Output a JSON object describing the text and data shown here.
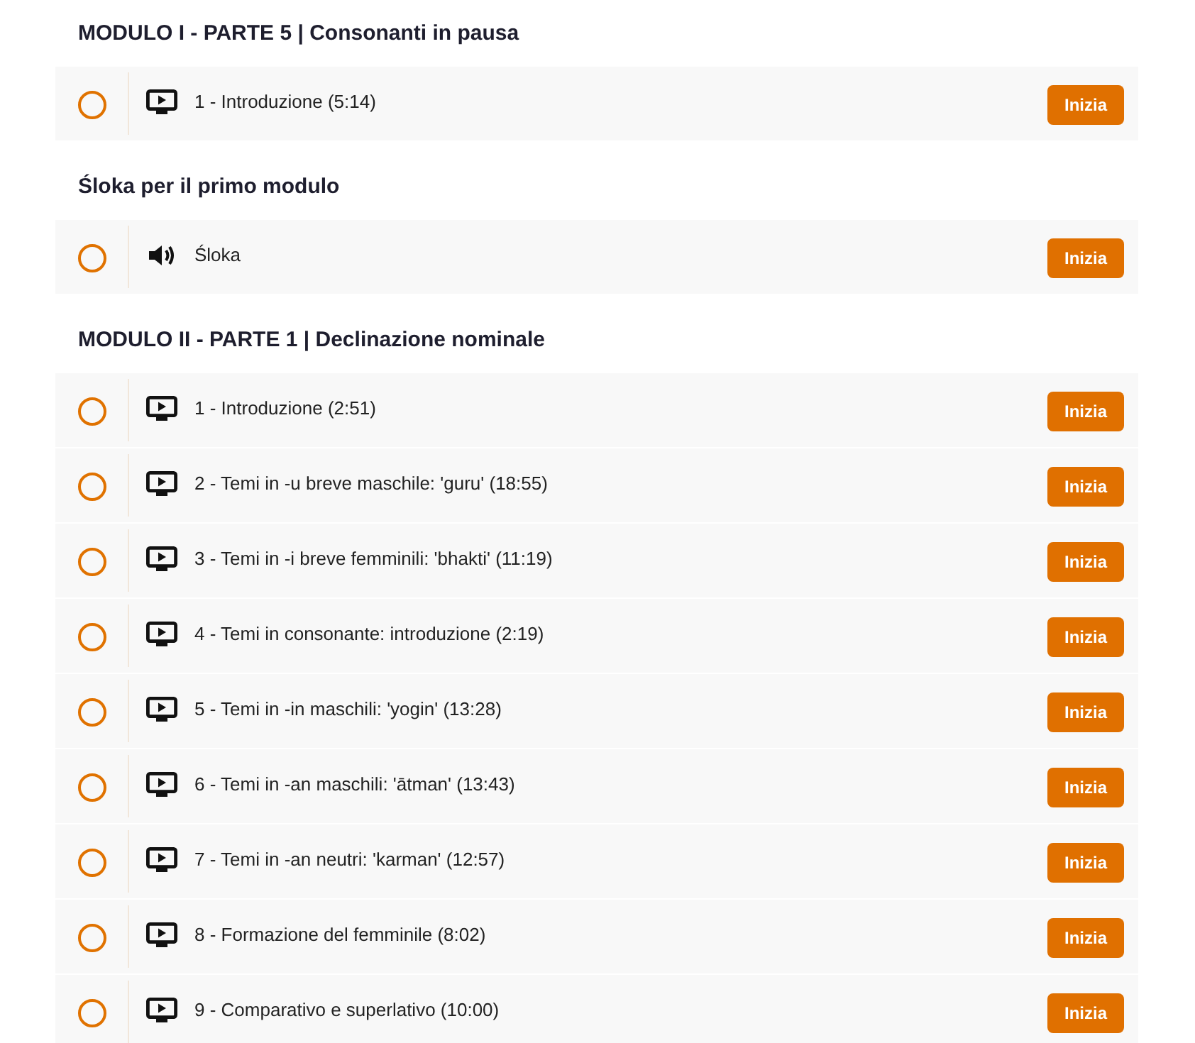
{
  "sections": [
    {
      "title": "MODULO I - PARTE 5 | Consonanti in pausa",
      "lessons": [
        {
          "kind": "video",
          "title": "1 - Introduzione (5:14)",
          "completed": false,
          "action": "Inizia"
        }
      ]
    },
    {
      "title": "Śloka per il primo modulo",
      "lessons": [
        {
          "kind": "audio",
          "title": "Śloka",
          "completed": false,
          "action": "Inizia"
        }
      ]
    },
    {
      "title": "MODULO II - PARTE 1 | Declinazione nominale",
      "lessons": [
        {
          "kind": "video",
          "title": "1 - Introduzione (2:51)",
          "completed": false,
          "action": "Inizia"
        },
        {
          "kind": "video",
          "title": "2 - Temi in -u breve maschile: 'guru' (18:55)",
          "completed": false,
          "action": "Inizia"
        },
        {
          "kind": "video",
          "title": "3 - Temi in -i breve femminili: 'bhakti' (11:19)",
          "completed": false,
          "action": "Inizia"
        },
        {
          "kind": "video",
          "title": "4 - Temi in consonante: introduzione (2:19)",
          "completed": false,
          "action": "Inizia"
        },
        {
          "kind": "video",
          "title": "5 - Temi in -in maschili: 'yogin' (13:28)",
          "completed": false,
          "action": "Inizia"
        },
        {
          "kind": "video",
          "title": "6 - Temi in -an maschili: 'ātman' (13:43)",
          "completed": false,
          "action": "Inizia"
        },
        {
          "kind": "video",
          "title": "7 - Temi in -an neutri: 'karman' (12:57)",
          "completed": false,
          "action": "Inizia"
        },
        {
          "kind": "video",
          "title": "8 - Formazione del femminile (8:02)",
          "completed": false,
          "action": "Inizia"
        },
        {
          "kind": "video",
          "title": "9 - Comparativo e superlativo (10:00)",
          "completed": false,
          "action": "Inizia"
        }
      ]
    }
  ]
}
